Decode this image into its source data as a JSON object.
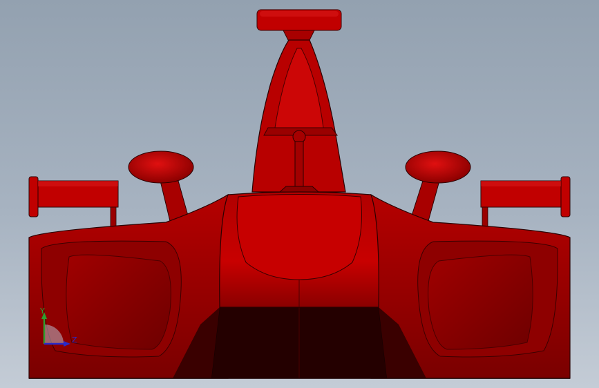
{
  "viewport": {
    "background_top": "#93a1b0",
    "background_bottom": "#c4ccd6"
  },
  "model": {
    "body_color": "#c40000",
    "shade_color": "#8a0000",
    "dark_color": "#240000",
    "edge_color": "#2a0000"
  },
  "triad": {
    "y_label": "Y",
    "z_label": "Z",
    "y_color": "#2e9e2e",
    "z_color": "#2a2ac8"
  }
}
